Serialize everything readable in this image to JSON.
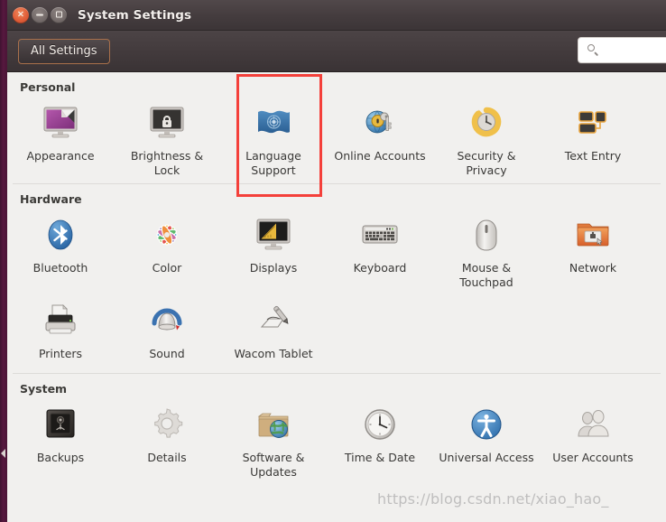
{
  "window": {
    "title": "System Settings",
    "buttons": {
      "close": "close-button",
      "minimize": "minimize-button",
      "maximize": "maximize-button"
    }
  },
  "toolbar": {
    "all_settings_label": "All Settings",
    "search_placeholder": "",
    "search_value": ""
  },
  "highlight": {
    "target": "Language Support",
    "color": "#f4403a"
  },
  "watermark": "https://blog.csdn.net/xiao_hao_",
  "sections": [
    {
      "title": "Personal",
      "rows": [
        [
          {
            "label": "Appearance",
            "icon": "appearance-icon"
          },
          {
            "label": "Brightness & Lock",
            "icon": "brightness-lock-icon"
          },
          {
            "label": "Language Support",
            "icon": "language-support-icon"
          },
          {
            "label": "Online Accounts",
            "icon": "online-accounts-icon"
          },
          {
            "label": "Security & Privacy",
            "icon": "security-privacy-icon"
          },
          {
            "label": "Text Entry",
            "icon": "text-entry-icon"
          }
        ]
      ]
    },
    {
      "title": "Hardware",
      "rows": [
        [
          {
            "label": "Bluetooth",
            "icon": "bluetooth-icon"
          },
          {
            "label": "Color",
            "icon": "color-icon"
          },
          {
            "label": "Displays",
            "icon": "displays-icon"
          },
          {
            "label": "Keyboard",
            "icon": "keyboard-icon"
          },
          {
            "label": "Mouse & Touchpad",
            "icon": "mouse-touchpad-icon"
          },
          {
            "label": "Network",
            "icon": "network-icon"
          }
        ],
        [
          {
            "label": "Printers",
            "icon": "printers-icon"
          },
          {
            "label": "Sound",
            "icon": "sound-icon"
          },
          {
            "label": "Wacom Tablet",
            "icon": "wacom-tablet-icon"
          }
        ]
      ]
    },
    {
      "title": "System",
      "rows": [
        [
          {
            "label": "Backups",
            "icon": "backups-icon"
          },
          {
            "label": "Details",
            "icon": "details-icon"
          },
          {
            "label": "Software & Updates",
            "icon": "software-updates-icon"
          },
          {
            "label": "Time & Date",
            "icon": "time-date-icon"
          },
          {
            "label": "Universal Access",
            "icon": "universal-access-icon"
          },
          {
            "label": "User Accounts",
            "icon": "user-accounts-icon"
          }
        ]
      ]
    }
  ]
}
